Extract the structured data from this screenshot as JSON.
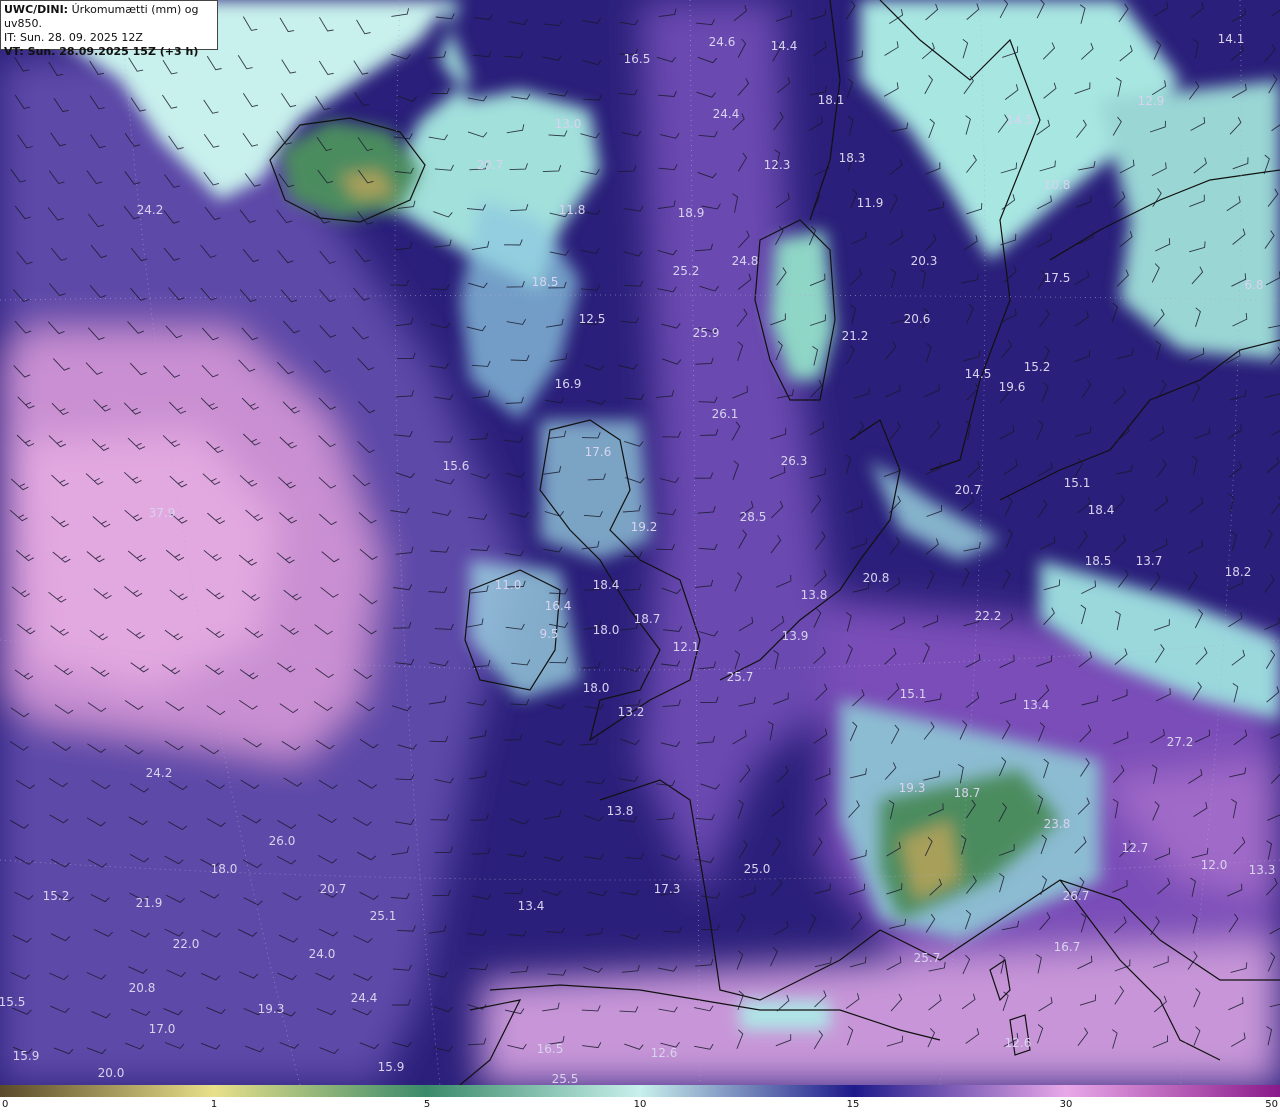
{
  "header": {
    "model_prefix": "UWC/DINI:",
    "product": " Úrkomumætti (mm) og uv850.",
    "init_time": "IT: Sun. 28. 09. 2025 12Z",
    "valid_time": "VT: Sun. 28.09.2025 15Z (+3 h)"
  },
  "colorbar": {
    "ticks": [
      "0",
      "1",
      "5",
      "10",
      "15",
      "30",
      "50"
    ],
    "colors": [
      "#5a4a2a",
      "#e8e08a",
      "#3a8a6a",
      "#c8f0ec",
      "#1e1a8a",
      "#e8a8e8",
      "#8a1a8a"
    ]
  },
  "colors": {
    "ocean_deep": "#2a1f7a",
    "moist_purple": "#6a4aa8",
    "moist_pink": "#d49ad6",
    "dry_cyan": "#a6e6e2",
    "land_green": "#4a8a5a",
    "coast": "#111111",
    "value_label": "#d8d3ee"
  },
  "map_values": [
    {
      "id": "v01",
      "text": "16.5"
    },
    {
      "id": "v02",
      "text": "24.6"
    },
    {
      "id": "v03",
      "text": "14.4"
    },
    {
      "id": "v04",
      "text": "14.1"
    },
    {
      "id": "v05",
      "text": "18.1"
    },
    {
      "id": "v06",
      "text": "12.9"
    },
    {
      "id": "v07",
      "text": "13.0"
    },
    {
      "id": "v08",
      "text": "24.4"
    },
    {
      "id": "v09",
      "text": "14.5"
    },
    {
      "id": "v10",
      "text": "20.7"
    },
    {
      "id": "v11",
      "text": "12.3"
    },
    {
      "id": "v12",
      "text": "18.3"
    },
    {
      "id": "v13",
      "text": "10.8"
    },
    {
      "id": "v14",
      "text": "24.2"
    },
    {
      "id": "v15",
      "text": "11.8"
    },
    {
      "id": "v16",
      "text": "18.9"
    },
    {
      "id": "v17",
      "text": "11.9"
    },
    {
      "id": "v18",
      "text": "24.8"
    },
    {
      "id": "v19",
      "text": "20.3"
    },
    {
      "id": "v20",
      "text": "25.2"
    },
    {
      "id": "v21",
      "text": "17.5"
    },
    {
      "id": "v22",
      "text": "18.5"
    },
    {
      "id": "v23",
      "text": "6.8"
    },
    {
      "id": "v24",
      "text": "12.5"
    },
    {
      "id": "v25",
      "text": "20.6"
    },
    {
      "id": "v26",
      "text": "25.9"
    },
    {
      "id": "v27",
      "text": "21.2"
    },
    {
      "id": "v28",
      "text": "15.2"
    },
    {
      "id": "v29",
      "text": "14.5"
    },
    {
      "id": "v30",
      "text": "16.9"
    },
    {
      "id": "v31",
      "text": "19.6"
    },
    {
      "id": "v32",
      "text": "26.1"
    },
    {
      "id": "v33",
      "text": "17.6"
    },
    {
      "id": "v34",
      "text": "15.6"
    },
    {
      "id": "v35",
      "text": "26.3"
    },
    {
      "id": "v36",
      "text": "15.1"
    },
    {
      "id": "v37",
      "text": "20.7"
    },
    {
      "id": "v38",
      "text": "18.4"
    },
    {
      "id": "v39",
      "text": "28.5"
    },
    {
      "id": "v40",
      "text": "37.9"
    },
    {
      "id": "v41",
      "text": "19.2"
    },
    {
      "id": "v42",
      "text": "18.5"
    },
    {
      "id": "v43",
      "text": "13.7"
    },
    {
      "id": "v44",
      "text": "18.2"
    },
    {
      "id": "v45",
      "text": "20.8"
    },
    {
      "id": "v46",
      "text": "18.4"
    },
    {
      "id": "v47",
      "text": "11.0"
    },
    {
      "id": "v48",
      "text": "13.8"
    },
    {
      "id": "v49",
      "text": "16.4"
    },
    {
      "id": "v50",
      "text": "18.7"
    },
    {
      "id": "v51",
      "text": "22.2"
    },
    {
      "id": "v52",
      "text": "9.5"
    },
    {
      "id": "v53",
      "text": "18.0"
    },
    {
      "id": "v54",
      "text": "13.9"
    },
    {
      "id": "v55",
      "text": "12.1"
    },
    {
      "id": "v56",
      "text": "25.7"
    },
    {
      "id": "v57",
      "text": "18.0"
    },
    {
      "id": "v58",
      "text": "15.1"
    },
    {
      "id": "v59",
      "text": "13.4"
    },
    {
      "id": "v60",
      "text": "13.2"
    },
    {
      "id": "v61",
      "text": "27.2"
    },
    {
      "id": "v62",
      "text": "24.2"
    },
    {
      "id": "v63",
      "text": "19.3"
    },
    {
      "id": "v64",
      "text": "18.7"
    },
    {
      "id": "v65",
      "text": "13.8"
    },
    {
      "id": "v66",
      "text": "23.8"
    },
    {
      "id": "v67",
      "text": "26.0"
    },
    {
      "id": "v68",
      "text": "12.7"
    },
    {
      "id": "v69",
      "text": "18.0"
    },
    {
      "id": "v70",
      "text": "25.0"
    },
    {
      "id": "v71",
      "text": "12.0"
    },
    {
      "id": "v72",
      "text": "13.3"
    },
    {
      "id": "v73",
      "text": "15.2"
    },
    {
      "id": "v74",
      "text": "20.7"
    },
    {
      "id": "v75",
      "text": "17.3"
    },
    {
      "id": "v76",
      "text": "21.9"
    },
    {
      "id": "v77",
      "text": "25.1"
    },
    {
      "id": "v78",
      "text": "13.4"
    },
    {
      "id": "v79",
      "text": "26.7"
    },
    {
      "id": "v80",
      "text": "22.0"
    },
    {
      "id": "v81",
      "text": "24.0"
    },
    {
      "id": "v82",
      "text": "16.7"
    },
    {
      "id": "v83",
      "text": "20.8"
    },
    {
      "id": "v84",
      "text": "24.4"
    },
    {
      "id": "v85",
      "text": "25.7"
    },
    {
      "id": "v86",
      "text": "15.5"
    },
    {
      "id": "v87",
      "text": "19.3"
    },
    {
      "id": "v88",
      "text": "17.0"
    },
    {
      "id": "v89",
      "text": "12.6"
    },
    {
      "id": "v90",
      "text": "16.5"
    },
    {
      "id": "v91",
      "text": "12.6"
    },
    {
      "id": "v92",
      "text": "15.9"
    },
    {
      "id": "v93",
      "text": "20.0"
    },
    {
      "id": "v94",
      "text": "15.9"
    },
    {
      "id": "v95",
      "text": "25.5"
    }
  ]
}
